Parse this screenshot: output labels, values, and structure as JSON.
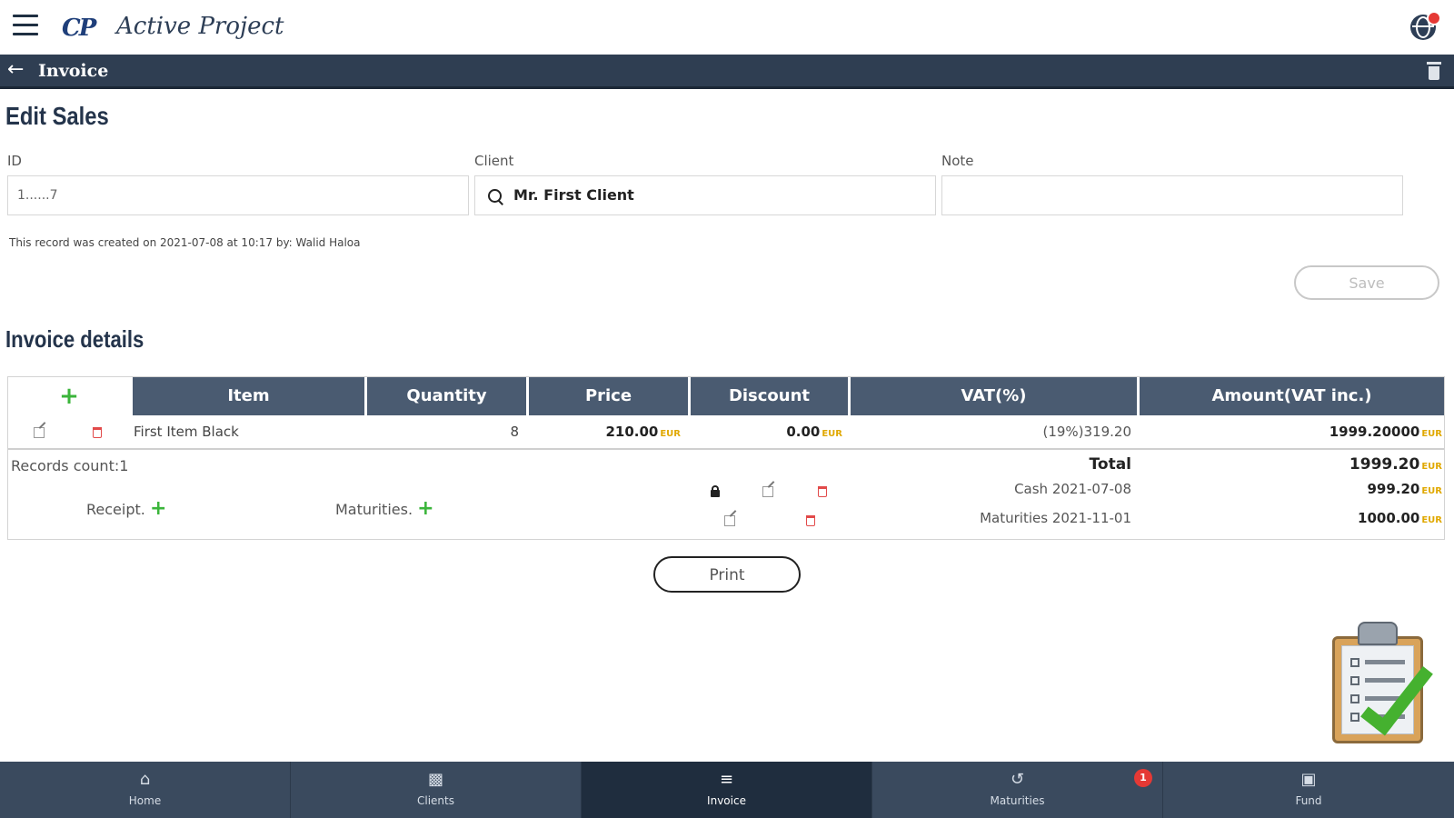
{
  "header": {
    "logo_mark": "CP",
    "app_title": "Active Project"
  },
  "titlebar": {
    "title": "Invoice"
  },
  "form": {
    "heading": "Edit Sales",
    "id_label": "ID",
    "id_value": "1......7",
    "client_label": "Client",
    "client_value": "Mr. First Client",
    "note_label": "Note",
    "note_value": "",
    "created_text": "This record was created on 2021-07-08 at 10:17 by: Walid Haloa",
    "save_label": "Save"
  },
  "details": {
    "heading": "Invoice details",
    "columns": [
      "Item",
      "Quantity",
      "Price",
      "Discount",
      "VAT(%)",
      "Amount(VAT inc.)"
    ],
    "rows": [
      {
        "item": "First Item Black",
        "quantity": "8",
        "price": "210.00",
        "discount": "0.00",
        "vat": "(19%)319.20",
        "amount": "1999.20000"
      }
    ],
    "currency": "EUR",
    "records_count": "Records count:1",
    "total_label": "Total",
    "total_value": "1999.20",
    "receipt_label": "Receipt.",
    "maturities_label": "Maturities.",
    "payments": [
      {
        "label": "Cash 2021-07-08",
        "amount": "999.20"
      },
      {
        "label": "Maturities 2021-11-01",
        "amount": "1000.00"
      }
    ]
  },
  "print_label": "Print",
  "nav": {
    "items": [
      {
        "label": "Home",
        "icon": "home-icon"
      },
      {
        "label": "Clients",
        "icon": "clients-icon"
      },
      {
        "label": "Invoice",
        "icon": "list-icon"
      },
      {
        "label": "Maturities",
        "icon": "history-icon"
      },
      {
        "label": "Fund",
        "icon": "fund-icon"
      }
    ],
    "maturities_badge": "1",
    "active": "Invoice"
  },
  "colors": {
    "titlebar": "#2f3e52",
    "table_header": "#4a5b71",
    "nav_bar": "#3a4a5e",
    "add_green": "#3bb53b",
    "delete_red": "#e24a4a",
    "currency_gold": "#e0a800"
  }
}
